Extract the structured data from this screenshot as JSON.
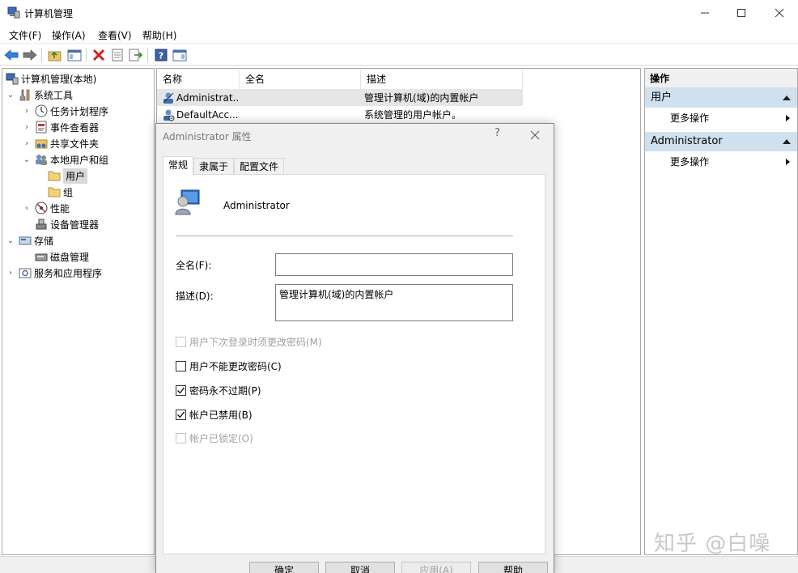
{
  "window": {
    "title": "计算机管理"
  },
  "menu": [
    "文件(F)",
    "操作(A)",
    "查看(V)",
    "帮助(H)"
  ],
  "tree": {
    "root": "计算机管理(本地)",
    "system_tools": "系统工具",
    "task_scheduler": "任务计划程序",
    "event_viewer": "事件查看器",
    "shared_folders": "共享文件夹",
    "local_users_groups": "本地用户和组",
    "users": "用户",
    "groups": "组",
    "performance": "性能",
    "device_manager": "设备管理器",
    "storage": "存储",
    "disk_management": "磁盘管理",
    "services_apps": "服务和应用程序"
  },
  "list": {
    "columns": [
      "名称",
      "全名",
      "描述"
    ],
    "rows": [
      {
        "name": "Administrat...",
        "fullname": "",
        "desc": "管理计算机(域)的内置帐户"
      },
      {
        "name": "DefaultAcc...",
        "fullname": "",
        "desc": "系统管理的用户帐户。"
      }
    ]
  },
  "actions": {
    "title": "操作",
    "section1": "用户",
    "more1": "更多操作",
    "section2": "Administrator",
    "more2": "更多操作"
  },
  "dialog": {
    "title": "Administrator 属性",
    "help": "?",
    "tabs": [
      "常规",
      "隶属于",
      "配置文件"
    ],
    "username": "Administrator",
    "fullname_label": "全名(F):",
    "fullname_value": "",
    "desc_label": "描述(D):",
    "desc_value": "管理计算机(域)的内置帐户",
    "checkboxes": [
      {
        "label": "用户下次登录时须更改密码(M)",
        "checked": false,
        "disabled": true
      },
      {
        "label": "用户不能更改密码(C)",
        "checked": false,
        "disabled": false
      },
      {
        "label": "密码永不过期(P)",
        "checked": true,
        "disabled": false
      },
      {
        "label": "帐户已禁用(B)",
        "checked": true,
        "disabled": false
      },
      {
        "label": "帐户已锁定(O)",
        "checked": false,
        "disabled": true
      }
    ],
    "buttons": {
      "ok": "确定",
      "cancel": "取消",
      "apply": "应用(A)",
      "help": "帮助"
    }
  },
  "watermark": "知乎 @白噪"
}
